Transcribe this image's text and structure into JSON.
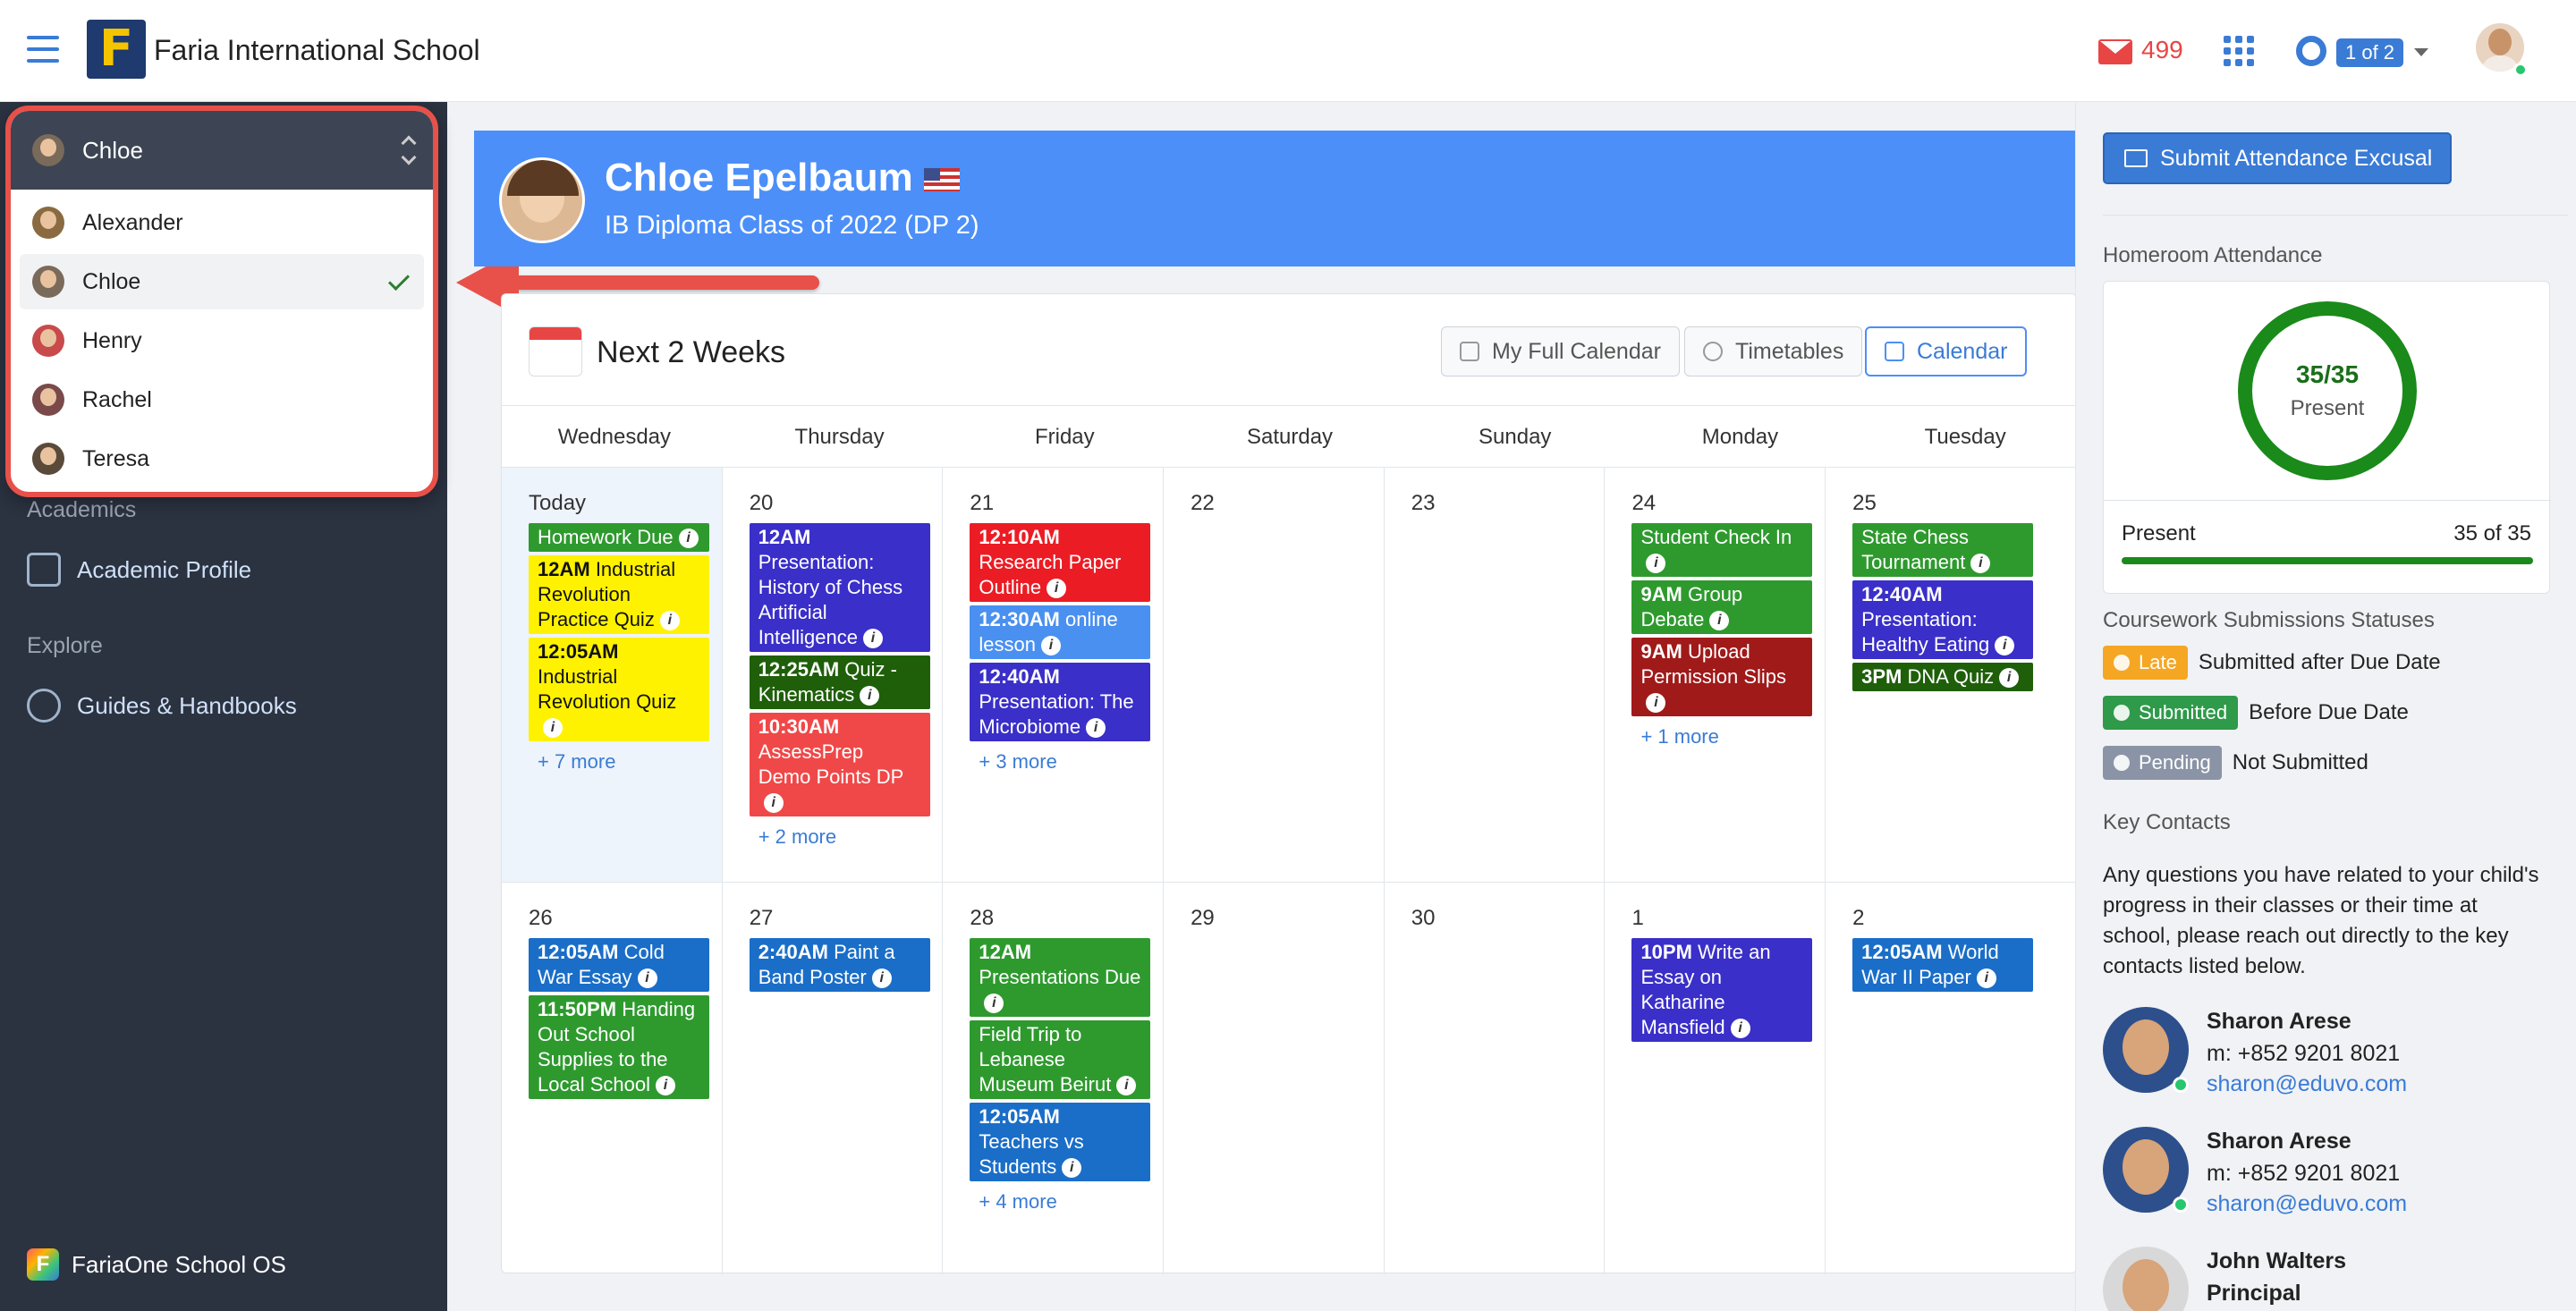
{
  "topbar": {
    "school_name": "Faria International School",
    "logo_letter": "F",
    "mail_count": "499",
    "badge": "1 of 2"
  },
  "sidebar": {
    "sections": [
      {
        "label": "Academics",
        "items": [
          {
            "label": "Academic Profile",
            "icon": "document-icon"
          }
        ]
      },
      {
        "label": "Explore",
        "items": [
          {
            "label": "Guides & Handbooks",
            "icon": "people-icon"
          }
        ]
      }
    ],
    "footer": "FariaOne School OS",
    "footer_logo": "F"
  },
  "child_selector": {
    "selected": "Chloe",
    "options": [
      "Alexander",
      "Chloe",
      "Henry",
      "Rachel",
      "Teresa"
    ]
  },
  "student": {
    "name": "Chloe Epelbaum",
    "class": "IB Diploma Class of 2022 (DP 2)"
  },
  "calendar": {
    "title": "Next 2 Weeks",
    "buttons": {
      "full": "My Full Calendar",
      "timetables": "Timetables",
      "calendar": "Calendar"
    },
    "days": [
      "Wednesday",
      "Thursday",
      "Friday",
      "Saturday",
      "Sunday",
      "Monday",
      "Tuesday"
    ],
    "weeks": [
      [
        {
          "date": "Today",
          "today": true,
          "events": [
            {
              "time": "",
              "title": "Homework Due",
              "color": "#2e9a2e"
            },
            {
              "time": "12AM",
              "title": "Industrial Revolution Practice Quiz",
              "color": "#fff200"
            },
            {
              "time": "12:05AM",
              "title": "Industrial Revolution Quiz",
              "color": "#fff200"
            }
          ],
          "more": "+ 7 more"
        },
        {
          "date": "20",
          "events": [
            {
              "time": "12AM",
              "title": "Presentation: History of Chess Artificial Intelligence",
              "color": "#3a2fc8"
            },
            {
              "time": "12:25AM",
              "title": "Quiz - Kinematics",
              "color": "#1f5f0a"
            },
            {
              "time": "10:30AM",
              "title": "AssessPrep Demo Points DP",
              "color": "#f04848"
            }
          ],
          "more": "+ 2 more"
        },
        {
          "date": "21",
          "events": [
            {
              "time": "12:10AM",
              "title": "Research Paper Outline",
              "color": "#ec1c24"
            },
            {
              "time": "12:30AM",
              "title": "online lesson",
              "color": "#4a90f0"
            },
            {
              "time": "12:40AM",
              "title": "Presentation: The Microbiome",
              "color": "#3a2fc8"
            }
          ],
          "more": "+ 3 more"
        },
        {
          "date": "22",
          "events": [],
          "more": ""
        },
        {
          "date": "23",
          "events": [],
          "more": ""
        },
        {
          "date": "24",
          "events": [
            {
              "time": "",
              "title": "Student Check In",
              "color": "#2e9a2e"
            },
            {
              "time": "9AM",
              "title": "Group Debate",
              "color": "#2e9a2e"
            },
            {
              "time": "9AM",
              "title": "Upload Permission Slips",
              "color": "#a01a1a"
            }
          ],
          "more": "+ 1 more"
        },
        {
          "date": "25",
          "events": [
            {
              "time": "",
              "title": "State Chess Tournament",
              "color": "#2e9a2e"
            },
            {
              "time": "12:40AM",
              "title": "Presentation: Healthy Eating",
              "color": "#3a2fc8"
            },
            {
              "time": "3PM",
              "title": "DNA Quiz",
              "color": "#1f5f0a"
            }
          ],
          "more": ""
        }
      ],
      [
        {
          "date": "26",
          "events": [
            {
              "time": "12:05AM",
              "title": "Cold War Essay",
              "color": "#1a6ec8"
            },
            {
              "time": "11:50PM",
              "title": "Handing Out School Supplies to the Local School",
              "color": "#2e9a2e"
            }
          ],
          "more": ""
        },
        {
          "date": "27",
          "events": [
            {
              "time": "2:40AM",
              "title": "Paint a Band Poster",
              "color": "#1a6ec8"
            }
          ],
          "more": ""
        },
        {
          "date": "28",
          "events": [
            {
              "time": "12AM",
              "title": "Presentations Due",
              "color": "#2e9a2e"
            },
            {
              "time": "",
              "title": "Field Trip to Lebanese Museum Beirut",
              "color": "#2e9a2e"
            },
            {
              "time": "12:05AM",
              "title": "Teachers vs Students",
              "color": "#1a6ec8"
            }
          ],
          "more": "+ 4 more"
        },
        {
          "date": "29",
          "events": [],
          "more": ""
        },
        {
          "date": "30",
          "events": [],
          "more": ""
        },
        {
          "date": "1",
          "events": [
            {
              "time": "10PM",
              "title": "Write an Essay on Katharine Mansfield",
              "color": "#3a2fc8"
            }
          ],
          "more": ""
        },
        {
          "date": "2",
          "events": [
            {
              "time": "12:05AM",
              "title": "World War II Paper",
              "color": "#1a6ec8"
            }
          ],
          "more": ""
        }
      ]
    ]
  },
  "right": {
    "submit_button": "Submit Attendance Excusal",
    "homeroom_title": "Homeroom Attendance",
    "ring_value": "35/35",
    "ring_label": "Present",
    "present_label": "Present",
    "present_value": "35 of 35",
    "present_fraction": 1.0,
    "coursework_title": "Coursework Submissions Statuses",
    "statuses": [
      {
        "tag": "Late",
        "text": "Submitted after Due Date",
        "color": "#f5a623"
      },
      {
        "tag": "Submitted",
        "text": "Before Due Date",
        "color": "#2e9a4a"
      },
      {
        "tag": "Pending",
        "text": "Not Submitted",
        "color": "#8a94a6"
      }
    ],
    "key_contacts_title": "Key Contacts",
    "key_contacts_text": "Any questions you have related to your child's progress in their classes or their time at school, please reach out directly to the key contacts listed below.",
    "contacts": [
      {
        "name": "Sharon Arese",
        "phone": "m: +852 9201 8021",
        "email": "sharon@eduvo.com"
      },
      {
        "name": "Sharon Arese",
        "phone": "m: +852 9201 8021",
        "email": "sharon@eduvo.com"
      },
      {
        "name": "John Walters",
        "phone": "Principal",
        "email": ""
      }
    ]
  }
}
